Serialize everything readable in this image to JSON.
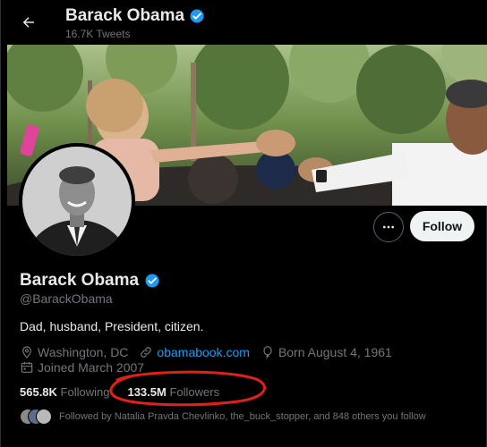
{
  "header": {
    "back_icon": "arrow-left-icon",
    "name": "Barack Obama",
    "tweet_count": "16.7K Tweets",
    "verified_icon": "verified-badge-icon"
  },
  "profile": {
    "name": "Barack Obama",
    "handle": "@BarackObama",
    "bio": "Dad, husband, President, citizen.",
    "location": "Washington, DC",
    "website": "obamabook.com",
    "birthday": "Born August 4, 1961",
    "joined": "Joined March 2007"
  },
  "actions": {
    "more_icon": "more-dots-icon",
    "follow_label": "Follow"
  },
  "stats": {
    "following_count": "565.8K",
    "following_label": "Following",
    "followers_count": "133.5M",
    "followers_label": "Followers"
  },
  "followed_by": {
    "text": "Followed by Natalia Pravda Chevlinko, the_buck_stopper, and 848 others you follow"
  },
  "colors": {
    "background": "#000000",
    "text_primary": "#e7e9ea",
    "text_secondary": "#71767b",
    "link": "#1d9bf0",
    "verified": "#1d9bf0",
    "follow_button_bg": "#eff3f4",
    "annotation": "#e0201a"
  }
}
